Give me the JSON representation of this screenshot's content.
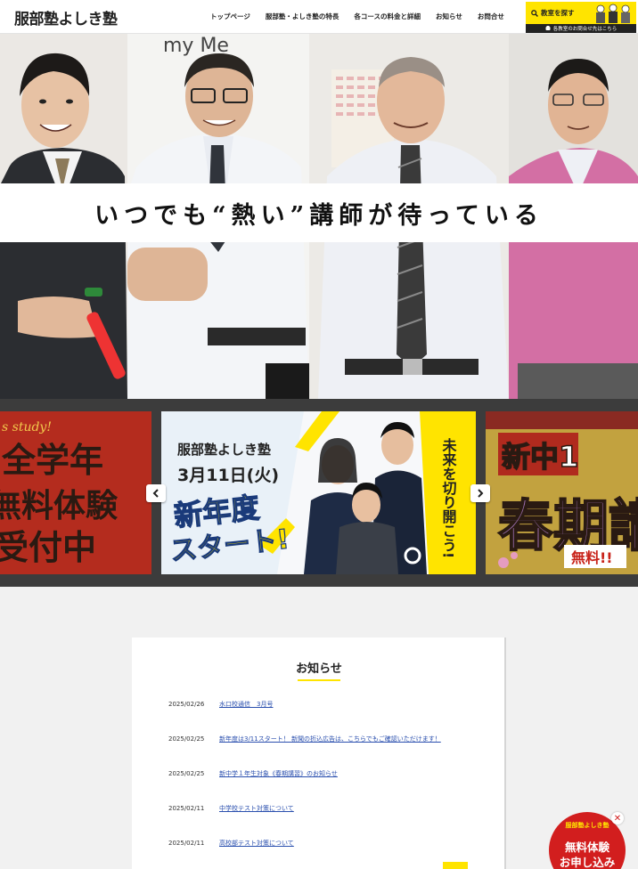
{
  "header": {
    "logo": "服部塾よしき塾",
    "nav": [
      "トップページ",
      "服部塾・よしき塾の特長",
      "各コースの料金と詳細",
      "お知らせ",
      "お問合せ"
    ],
    "find_button": "教室を探す",
    "contact_strip": "各教室のお問合せ先はこちら"
  },
  "hero": {
    "catchphrase": "いつでも“熱い”講師が待っている",
    "board_text": "my    Me"
  },
  "slider": {
    "left_slide": {
      "en": "s study!",
      "line1": "全学年",
      "line2": "無料体験",
      "line3": "受付中"
    },
    "center_slide": {
      "brand": "服部塾よしき塾",
      "date": "3月11日(火)",
      "title1": "新年度",
      "title2": "スタート!",
      "tagline": "未来を切り開こう!"
    },
    "right_slide": {
      "line1": "新中1",
      "line2": "春期講",
      "badge": "無料!!"
    }
  },
  "news": {
    "title": "お知らせ",
    "items": [
      {
        "date": "2025/02/26",
        "text": "水口校通信　3月号"
      },
      {
        "date": "2025/02/25",
        "text": "新年度は3/11スタート！ 新聞の折込広告は、こちらでもご確認いただけます！"
      },
      {
        "date": "2025/02/25",
        "text": "新中学１年生対象《春期講習》のお知らせ"
      },
      {
        "date": "2025/02/11",
        "text": "中学校テスト対策について"
      },
      {
        "date": "2025/02/11",
        "text": "高校部テスト対策について"
      }
    ]
  },
  "floating": {
    "brand": "服部塾よしき塾",
    "line1": "無料体験",
    "line2": "お申し込み",
    "close": "✕"
  },
  "colors": {
    "accent": "#ffe400",
    "link": "#2a4fae",
    "badge": "#d21e1e",
    "slider_bg": "#3c3c3c"
  }
}
